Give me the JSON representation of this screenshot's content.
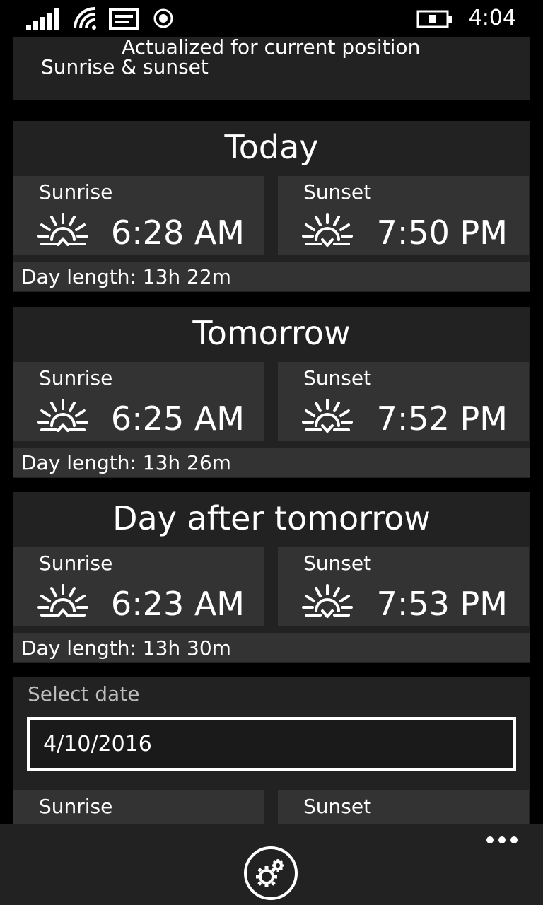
{
  "status_bar": {
    "time": "4:04",
    "icons": [
      "signal-icon",
      "wifi-icon",
      "message-icon",
      "location-icon",
      "battery-charging-icon"
    ]
  },
  "header": {
    "subtitle": "Actualized for current position",
    "title": "Sunrise & sunset"
  },
  "days": [
    {
      "title": "Today",
      "sunrise_label": "Sunrise",
      "sunrise_time": "6:28 AM",
      "sunset_label": "Sunset",
      "sunset_time": "7:50 PM",
      "day_length": "Day length: 13h 22m"
    },
    {
      "title": "Tomorrow",
      "sunrise_label": "Sunrise",
      "sunrise_time": "6:25 AM",
      "sunset_label": "Sunset",
      "sunset_time": "7:52 PM",
      "day_length": "Day length: 13h 26m"
    },
    {
      "title": "Day after tomorrow",
      "sunrise_label": "Sunrise",
      "sunrise_time": "6:23 AM",
      "sunset_label": "Sunset",
      "sunset_time": "7:53 PM",
      "day_length": "Day length: 13h 30m"
    }
  ],
  "picker": {
    "label": "Select date",
    "value": "4/10/2016",
    "sunrise_label": "Sunrise",
    "sunset_label": "Sunset"
  },
  "app_bar": {
    "settings_icon": "settings-gears-icon",
    "more_icon": "more-ellipsis-icon"
  }
}
